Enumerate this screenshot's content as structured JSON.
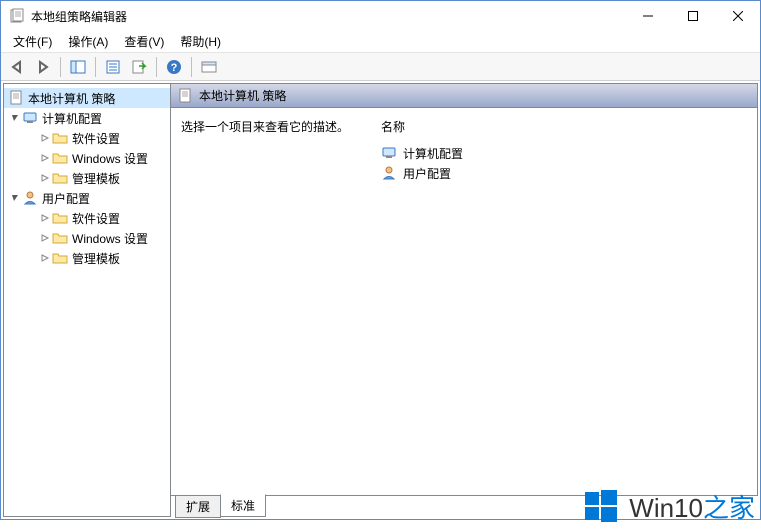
{
  "window": {
    "title": "本地组策略编辑器"
  },
  "menu": {
    "file": "文件(F)",
    "action": "操作(A)",
    "view": "查看(V)",
    "help": "帮助(H)"
  },
  "tree": {
    "root": "本地计算机 策略",
    "computer": "计算机配置",
    "user": "用户配置",
    "software": "软件设置",
    "windows": "Windows 设置",
    "templates": "管理模板"
  },
  "header": {
    "title": "本地计算机 策略"
  },
  "detail": {
    "prompt": "选择一个项目来查看它的描述。",
    "nameHeader": "名称",
    "items": {
      "computer": "计算机配置",
      "user": "用户配置"
    }
  },
  "tabs": {
    "extended": "扩展",
    "standard": "标准"
  },
  "watermark": {
    "brand": "Win10",
    "suffix": "之家"
  }
}
